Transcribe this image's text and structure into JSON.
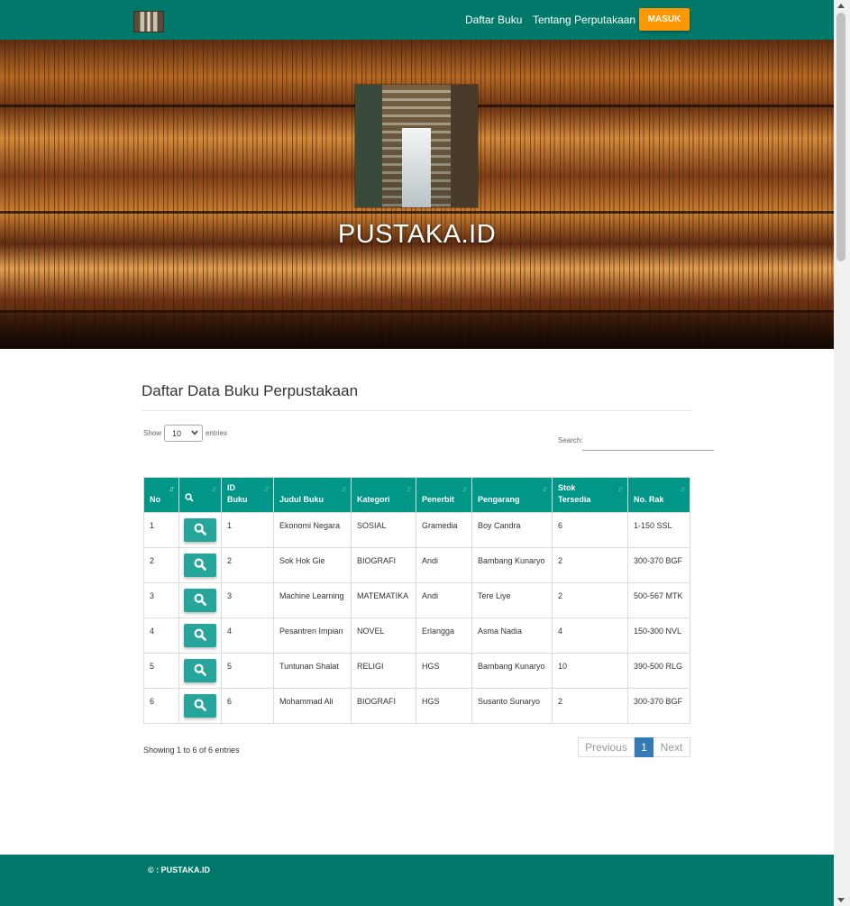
{
  "nav": {
    "logo_name": "library-logo",
    "links": [
      "Daftar Buku",
      "Tentang Perputakaan"
    ],
    "login_label": "MASUK"
  },
  "hero": {
    "title": "PUSTAKA.ID"
  },
  "section": {
    "title": "Daftar Data Buku Perpustakaan"
  },
  "controls": {
    "show_label": "Show",
    "entries_value": "10",
    "entries_label": "entries",
    "search_label": "Search:",
    "search_value": ""
  },
  "table": {
    "headers": [
      "No",
      "",
      "ID\nBuku",
      "Judul Buku",
      "Kategori",
      "Penerbit",
      "Pengarang",
      "Stok\nTersedia",
      "No. Rak"
    ],
    "rows": [
      {
        "no": "1",
        "id": "1",
        "judul": "Ekonomi Negara",
        "kategori": "SOSIAL",
        "penerbit": "Gramedia",
        "pengarang": "Boy Candra",
        "stok": "6",
        "rak": "1-150 SSL"
      },
      {
        "no": "2",
        "id": "2",
        "judul": "Sok Hok Gie",
        "kategori": "BIOGRAFI",
        "penerbit": "Andi",
        "pengarang": "Bambang Kunaryo",
        "stok": "2",
        "rak": "300-370 BGF"
      },
      {
        "no": "3",
        "id": "3",
        "judul": "Machine Learning",
        "kategori": "MATEMATIKA",
        "penerbit": "Andi",
        "pengarang": "Tere Liye",
        "stok": "2",
        "rak": "500-567 MTK"
      },
      {
        "no": "4",
        "id": "4",
        "judul": "Pesantren Impian",
        "kategori": "NOVEL",
        "penerbit": "Erlangga",
        "pengarang": "Asma Nadia",
        "stok": "4",
        "rak": "150-300 NVL"
      },
      {
        "no": "5",
        "id": "5",
        "judul": "Tuntunan Shalat",
        "kategori": "RELIGI",
        "penerbit": "HGS",
        "pengarang": "Bambang Kunaryo",
        "stok": "10",
        "rak": "390-500 RLG"
      },
      {
        "no": "6",
        "id": "6",
        "judul": "Mohammad Ali",
        "kategori": "BIOGRAFI",
        "penerbit": "HGS",
        "pengarang": "Susanto Sunaryo",
        "stok": "2",
        "rak": "300-370 BGF"
      }
    ]
  },
  "pagination": {
    "info": "Showing 1 to 6 of 6 entries",
    "prev": "Previous",
    "current": "1",
    "next": "Next"
  },
  "footer": {
    "copyright": "© : PUSTAKA.ID"
  },
  "colors": {
    "navbar": "#00796b",
    "table_header": "#009688",
    "view_button": "#26a69a",
    "login_button": "#ff9800",
    "active_page": "#337ab7"
  },
  "icons": {
    "view": "search-icon",
    "sort": "sort-icon"
  }
}
